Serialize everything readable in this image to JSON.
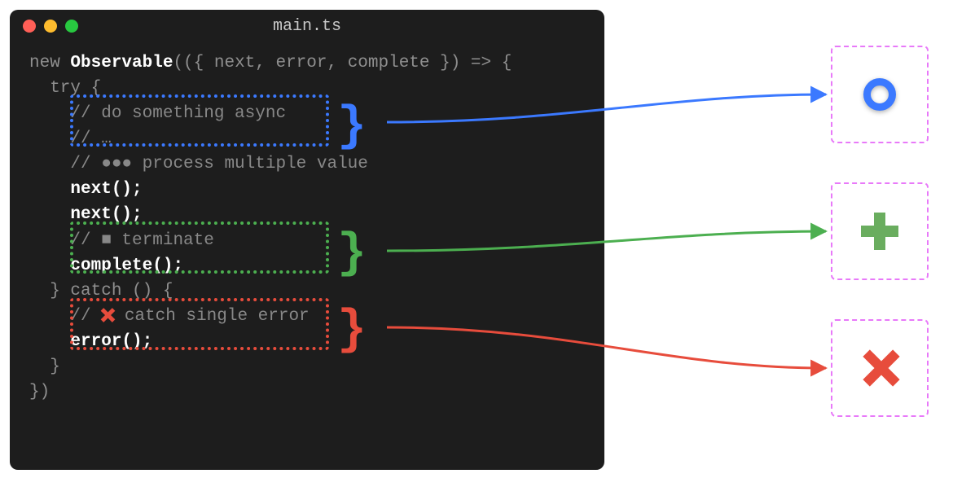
{
  "window": {
    "filename": "main.ts"
  },
  "code": {
    "line1_new": "new ",
    "line1_class": "Observable",
    "line1_rest": "(({ next, error, complete }) => {",
    "line2": "  try {",
    "line3": "    // do something async",
    "line4": "    // …",
    "line5_prefix": "    // ",
    "line5_dots": "●●●",
    "line5_text": " process multiple value",
    "line6": "    next();",
    "line7": "    next();",
    "line8_prefix": "    // ",
    "line8_square": "■",
    "line8_text": " terminate",
    "line9": "    complete();",
    "line10": "  } catch () {",
    "line11_prefix": "    // ",
    "line11_text": " catch single error",
    "line12": "    error();",
    "line13": "  }",
    "line14": "})"
  },
  "colors": {
    "blue": "#3b79ff",
    "green": "#4caf50",
    "red": "#e74c3c",
    "magenta": "#e879f9"
  },
  "targets": {
    "blue_icon": "circle-icon",
    "green_icon": "plus-icon",
    "red_icon": "x-icon"
  }
}
